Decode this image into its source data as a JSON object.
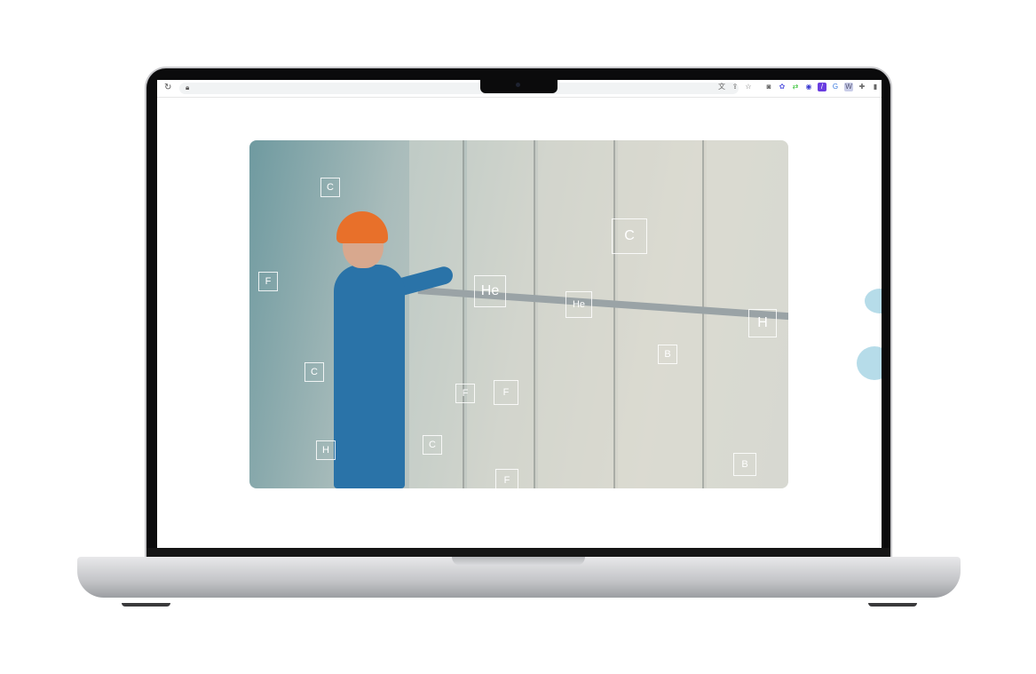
{
  "browser": {
    "toolbar_icons": [
      "translate-icon",
      "share-icon",
      "star-icon",
      "camera-icon",
      "extension-badge-icon",
      "sync-icon",
      "globe-icon",
      "vpn-icon",
      "translate-extension-icon",
      "reader-icon",
      "puzzle-icon",
      "sidebar-icon"
    ]
  },
  "hero_image": {
    "element_labels": [
      "C",
      "C",
      "He",
      "He",
      "H",
      "F",
      "F",
      "F",
      "B",
      "C",
      "H",
      "B",
      "C",
      "F"
    ]
  },
  "colors": {
    "accent_blob": "#b6dce9",
    "bezel": "#0b0b0c"
  }
}
